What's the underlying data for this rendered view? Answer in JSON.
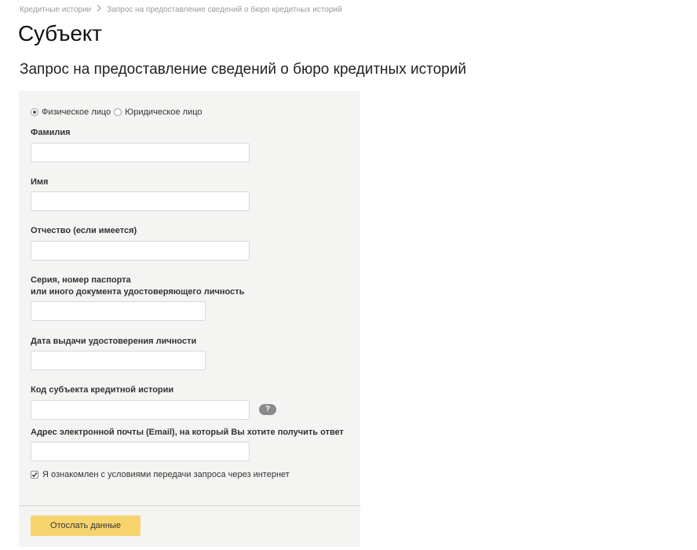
{
  "breadcrumb": {
    "items": [
      "Кредитные истории",
      "Запрос на предоставление сведений о бюро кредитных историй"
    ]
  },
  "page_title": "Субъект",
  "form_title": "Запрос на предоставление сведений о бюро кредитных историй",
  "subject_type": {
    "options": [
      "Физическое лицо",
      "Юридическое лицо"
    ],
    "selected": "Физическое лицо"
  },
  "fields": {
    "last_name": {
      "label": "Фамилия",
      "value": ""
    },
    "first_name": {
      "label": "Имя",
      "value": ""
    },
    "patronymic": {
      "label": "Отчество (если имеется)",
      "value": ""
    },
    "passport": {
      "label_line1": "Серия, номер паспорта",
      "label_line2": "или иного документа удостоверяющего личность",
      "value": ""
    },
    "issue_date": {
      "label": "Дата выдачи удостоверения личности",
      "value": ""
    },
    "subject_code": {
      "label": "Код субъекта кредитной истории",
      "value": "",
      "help": "?"
    },
    "email": {
      "label": "Адрес электронной почты (Email), на который Вы хотите получить ответ",
      "value": ""
    }
  },
  "agreement": {
    "label": "Я ознакомлен с условиями передачи запроса через интернет",
    "checked": true
  },
  "submit": {
    "label": "Отослать данные"
  },
  "colors": {
    "panel_bg": "#f4f4f2",
    "button_bg": "#f7d46d",
    "breadcrumb_text": "#9a9a9a"
  }
}
